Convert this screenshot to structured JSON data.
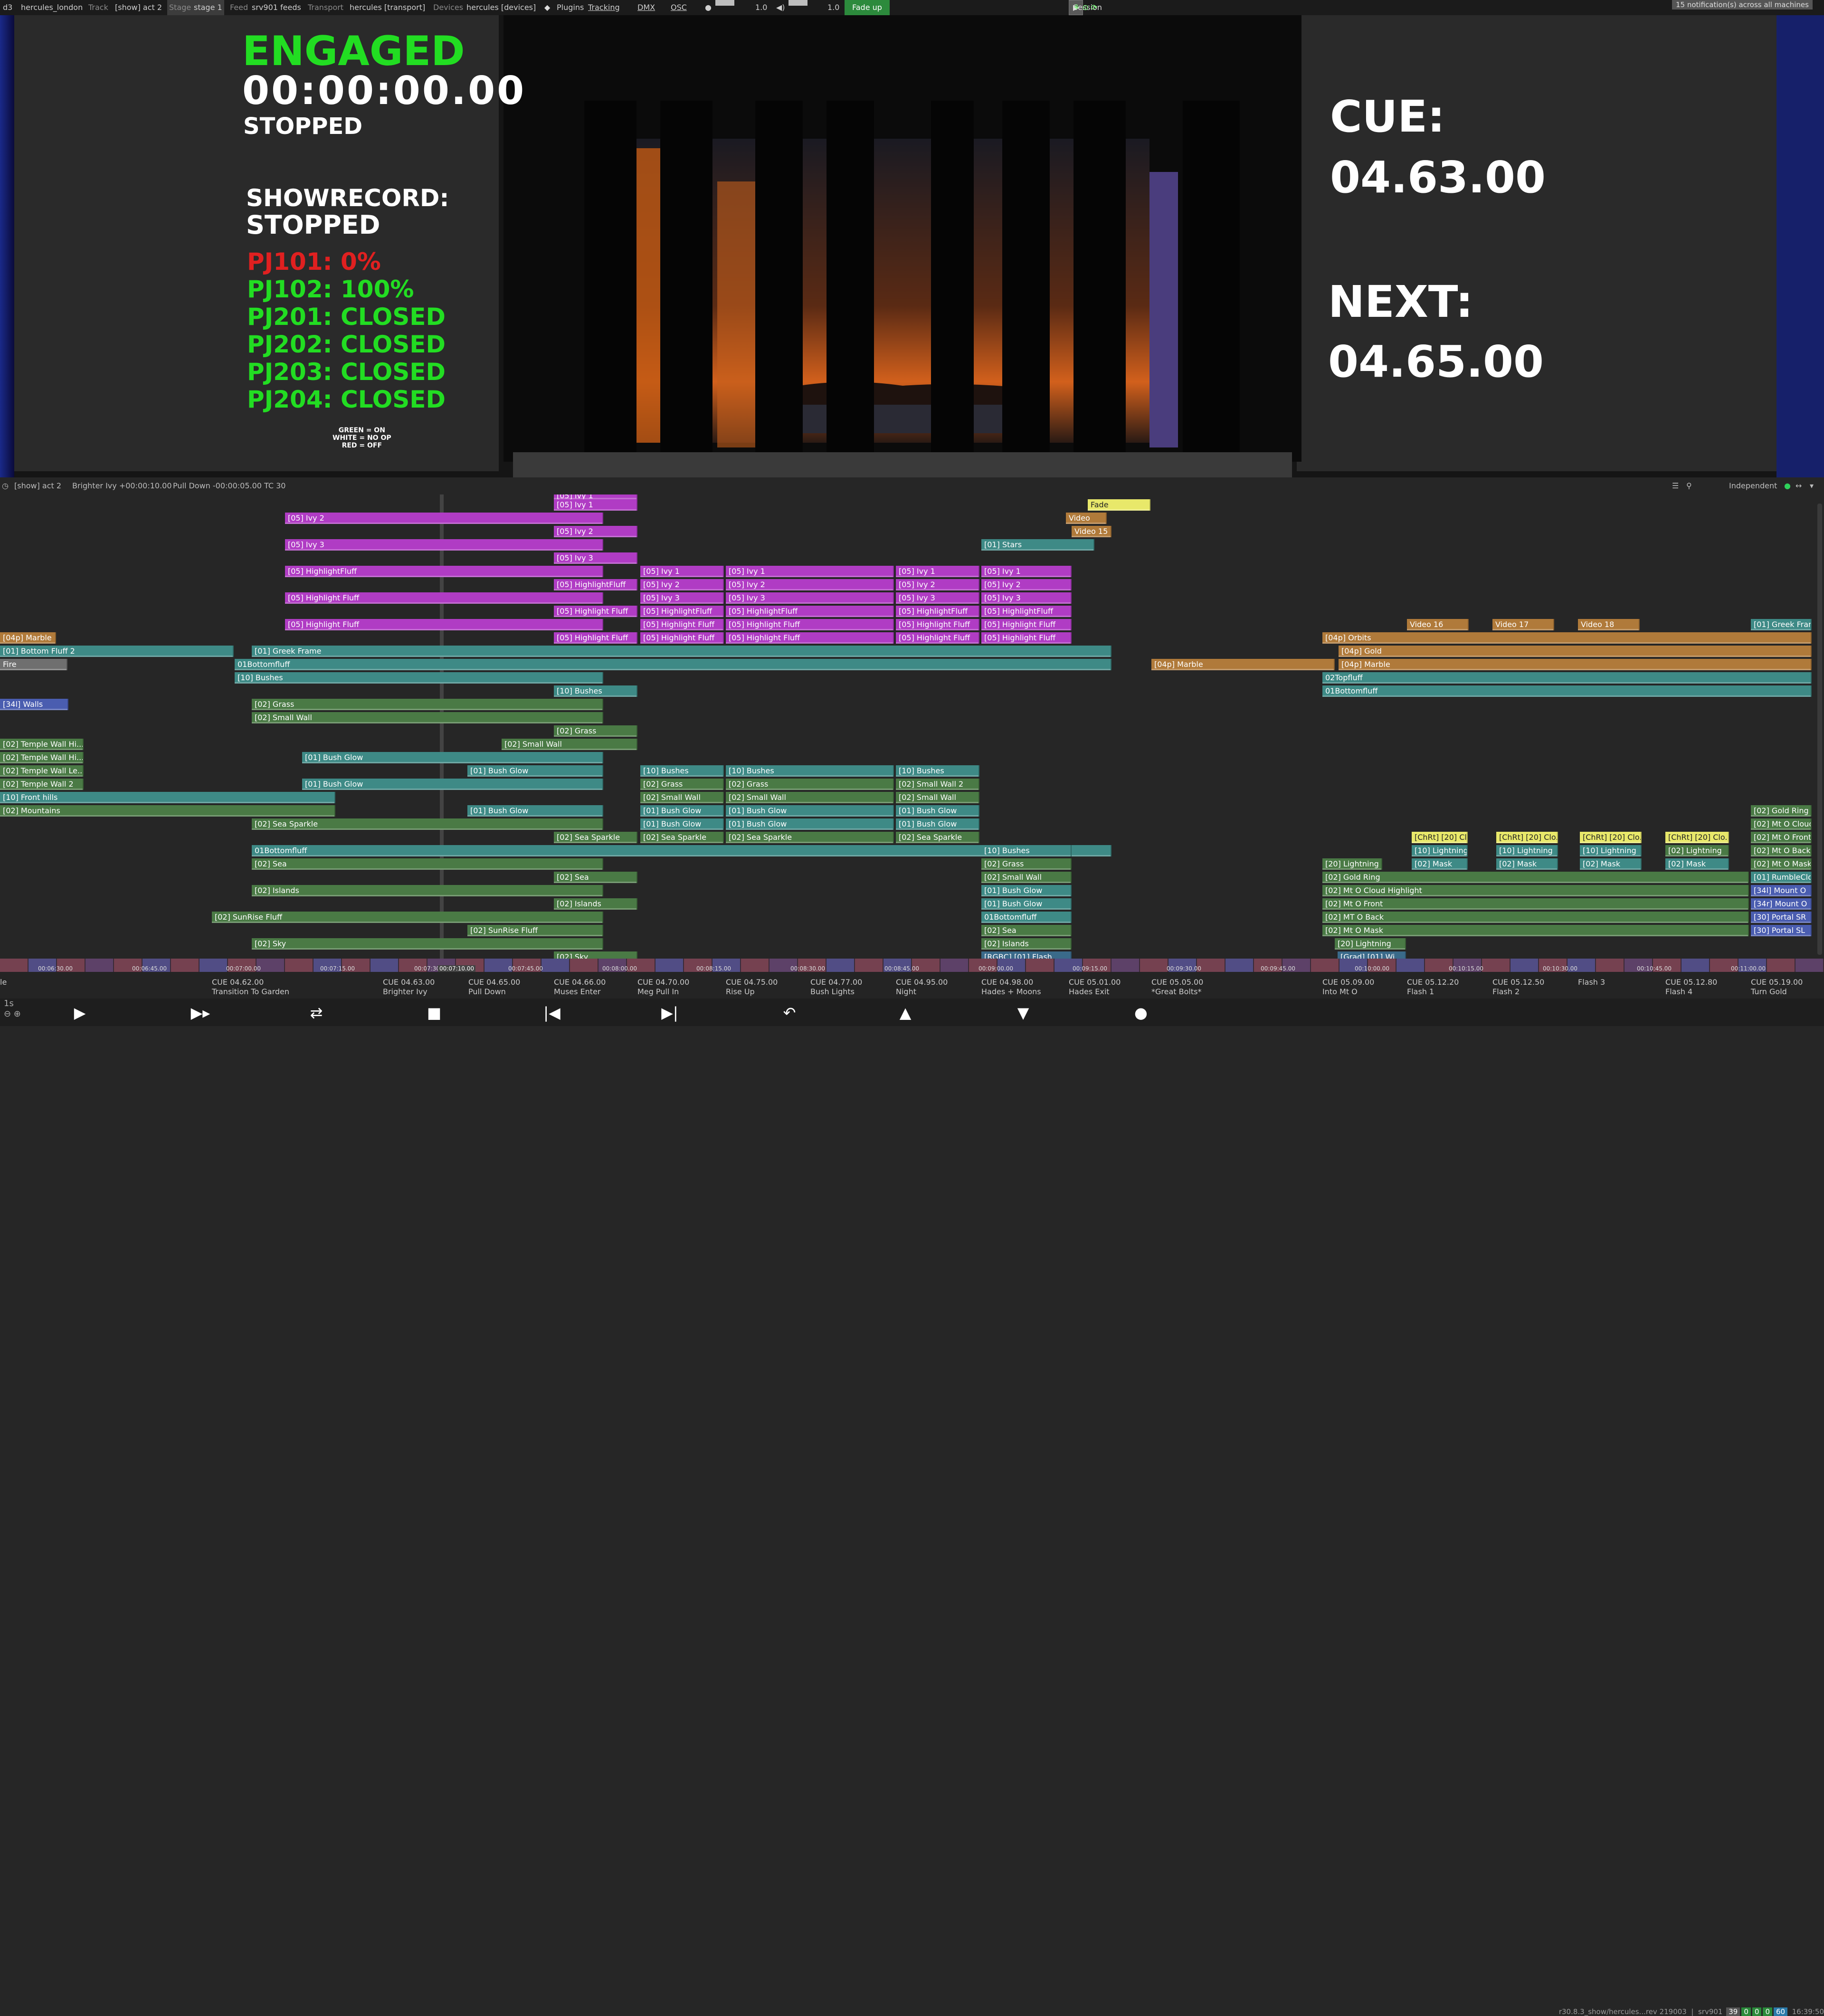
{
  "topbar": {
    "app": "d3",
    "project": "hercules_london",
    "track_label": "Track",
    "track_value": "[show] act 2",
    "stage_label": "Stage",
    "stage_value": "stage 1",
    "feed_label": "Feed",
    "feed_value": "srv901 feeds",
    "transport_label": "Transport",
    "transport_value": "hercules [transport]",
    "devices_label": "Devices",
    "devices_value": "hercules [devices]",
    "plugins": "Plugins",
    "tracking": "Tracking",
    "dmx": "DMX",
    "osc": "OSC",
    "bright_value": "1.0",
    "volume_value": "1.0",
    "fade_button": "Fade up",
    "session_label": "Session",
    "notifications": "15 notification(s) across all machines"
  },
  "hud": {
    "engaged": "ENGAGED",
    "timecode": "00:00:00.00",
    "status": "STOPPED",
    "showrecord_label": "SHOWRECORD:",
    "showrecord_status": "STOPPED",
    "pj_lines": [
      {
        "text": "PJ101: 0%",
        "color": "#e02020"
      },
      {
        "text": "PJ102: 100%",
        "color": "#22dd22"
      },
      {
        "text": "PJ201: CLOSED",
        "color": "#22dd22"
      },
      {
        "text": "PJ202: CLOSED",
        "color": "#22dd22"
      },
      {
        "text": "PJ203: CLOSED",
        "color": "#22dd22"
      },
      {
        "text": "PJ204: CLOSED",
        "color": "#22dd22"
      }
    ],
    "legend": [
      "GREEN = ON",
      "WHITE = NO OP",
      "RED = OFF"
    ],
    "cue_label": "CUE:",
    "cue_value": "04.63.00",
    "next_label": "NEXT:",
    "next_value": "04.65.00"
  },
  "timeline_header": {
    "track": "[show] act 2",
    "current_item": "Brighter Ivy +00:00:10.00",
    "next_item": "Pull Down -00:00:05.00",
    "tc": "TC 30",
    "mode": "Independent"
  },
  "colors": {
    "purple": "#b03cc4",
    "teal": "#3e8a86",
    "green": "#4a7a45",
    "brown": "#b07a3a",
    "gray": "#6f6f6f",
    "blue": "#4a5db0",
    "yellow": "#e8e86a",
    "slate": "#3a6a8a"
  },
  "layers": [
    {
      "t": "[05] Ivy 2",
      "r": 1,
      "c": "purple",
      "s": 0
    },
    {
      "t": "[05] Ivy 3",
      "r": 3,
      "c": "purple",
      "s": 0
    },
    {
      "t": "[05] HighlightFluff",
      "r": 5,
      "c": "purple",
      "s": 0
    },
    {
      "t": "[05] Highlight Fluff",
      "r": 7,
      "c": "purple",
      "s": 0
    },
    {
      "t": "[05] Highlight Fluff",
      "r": 9,
      "c": "purple",
      "s": 0
    },
    {
      "t": "[05] Ivy 1",
      "r": 0,
      "c": "purple",
      "s": 1
    },
    {
      "t": "[05] Ivy 2",
      "r": 2,
      "c": "purple",
      "s": 1
    },
    {
      "t": "[05] Ivy 3",
      "r": 4,
      "c": "purple",
      "s": 1
    },
    {
      "t": "[05] HighlightFluff",
      "r": 6,
      "c": "purple",
      "s": 1
    },
    {
      "t": "[05] Highlight Fluff",
      "r": 8,
      "c": "purple",
      "s": 1
    },
    {
      "t": "[05] Highlight Fluff",
      "r": 10,
      "c": "purple",
      "s": 1
    },
    {
      "t": "[05] Ivy 1",
      "r": 5,
      "c": "purple",
      "s": 2
    },
    {
      "t": "[05] Ivy 2",
      "r": 6,
      "c": "purple",
      "s": 2
    },
    {
      "t": "[05] Ivy 3",
      "r": 7,
      "c": "purple",
      "s": 2
    },
    {
      "t": "[05] HighlightFluff",
      "r": 8,
      "c": "purple",
      "s": 2
    },
    {
      "t": "[05] Highlight Fluff",
      "r": 9,
      "c": "purple",
      "s": 2
    },
    {
      "t": "[05] Highlight Fluff",
      "r": 10,
      "c": "purple",
      "s": 2
    },
    {
      "t": "[05] Ivy 1",
      "r": 5,
      "c": "purple",
      "s": 3
    },
    {
      "t": "[05] Ivy 2",
      "r": 6,
      "c": "purple",
      "s": 3
    },
    {
      "t": "[05] Ivy 3",
      "r": 7,
      "c": "purple",
      "s": 3
    },
    {
      "t": "[05] HighlightFluff",
      "r": 8,
      "c": "purple",
      "s": 3
    },
    {
      "t": "[05] Highlight Fluff",
      "r": 9,
      "c": "purple",
      "s": 3
    },
    {
      "t": "[05] Highlight Fluff",
      "r": 10,
      "c": "purple",
      "s": 3
    },
    {
      "t": "[05] Ivy 1",
      "r": 5,
      "c": "purple",
      "s": 4
    },
    {
      "t": "[05] Ivy 2",
      "r": 6,
      "c": "purple",
      "s": 4
    },
    {
      "t": "[05] Ivy 3",
      "r": 7,
      "c": "purple",
      "s": 4
    },
    {
      "t": "[05] HighlightFluff",
      "r": 8,
      "c": "purple",
      "s": 4
    },
    {
      "t": "[05] Highlight Fluff",
      "r": 9,
      "c": "purple",
      "s": 4
    },
    {
      "t": "[05] Highlight Fluff",
      "r": 10,
      "c": "purple",
      "s": 4
    },
    {
      "t": "[05] Ivy 1",
      "r": 5,
      "c": "purple",
      "s": 5
    },
    {
      "t": "[05] Ivy 2",
      "r": 6,
      "c": "purple",
      "s": 5
    },
    {
      "t": "[05] Ivy 3",
      "r": 7,
      "c": "purple",
      "s": 5
    },
    {
      "t": "[05] HighlightFluff",
      "r": 8,
      "c": "purple",
      "s": 5
    },
    {
      "t": "[05] Highlight Fluff",
      "r": 9,
      "c": "purple",
      "s": 5
    },
    {
      "t": "[05] Highlight Fluff",
      "r": 10,
      "c": "purple",
      "s": 5
    },
    {
      "t": "Fade",
      "r": 0,
      "c": "yellow",
      "s": 6
    },
    {
      "t": "Video",
      "r": 1,
      "c": "brown",
      "s": 7
    },
    {
      "t": "Video 15",
      "r": 2,
      "c": "brown",
      "s": 8
    },
    {
      "t": "[01] Stars",
      "r": 3,
      "c": "teal",
      "s": 9
    },
    {
      "t": "[04p] Marble",
      "r": 10,
      "c": "brown",
      "s": 10
    },
    {
      "t": "[01] Bottom Fluff 2",
      "r": 11,
      "c": "teal",
      "s": 11
    },
    {
      "t": "[01] Greek Frame",
      "r": 11,
      "c": "teal",
      "s": 12
    },
    {
      "t": "Fire",
      "r": 12,
      "c": "gray",
      "s": 13
    },
    {
      "t": "01Bottomfluff",
      "r": 12,
      "c": "teal",
      "s": 14
    },
    {
      "t": "[10] Bushes",
      "r": 13,
      "c": "teal",
      "s": 15
    },
    {
      "t": "[10] Bushes",
      "r": 14,
      "c": "teal",
      "s": 16
    },
    {
      "t": "[34l] Walls",
      "r": 15,
      "c": "blue",
      "s": 17
    },
    {
      "t": "[02] Grass",
      "r": 15,
      "c": "green",
      "s": 18
    },
    {
      "t": "[02] Small Wall",
      "r": 16,
      "c": "green",
      "s": 18
    },
    {
      "t": "[02] Grass",
      "r": 17,
      "c": "green",
      "s": 19
    },
    {
      "t": "[02] Small Wall",
      "r": 18,
      "c": "green",
      "s": 20
    },
    {
      "t": "[02] Temple Wall Hi...",
      "r": 18,
      "c": "green",
      "s": 21
    },
    {
      "t": "[02] Temple Wall Hi...",
      "r": 19,
      "c": "green",
      "s": 21
    },
    {
      "t": "[02] Temple Wall Le...",
      "r": 20,
      "c": "green",
      "s": 21
    },
    {
      "t": "[02] Temple Wall 2",
      "r": 21,
      "c": "green",
      "s": 21
    },
    {
      "t": "[01] Bush Glow",
      "r": 19,
      "c": "teal",
      "s": 22
    },
    {
      "t": "[01] Bush Glow",
      "r": 21,
      "c": "teal",
      "s": 22
    },
    {
      "t": "[01] Bush Glow",
      "r": 20,
      "c": "teal",
      "s": 23
    },
    {
      "t": "[10] Front hills",
      "r": 22,
      "c": "teal",
      "s": 24
    },
    {
      "t": "[02] Mountains",
      "r": 23,
      "c": "green",
      "s": 24
    },
    {
      "t": "[01] Bush Glow",
      "r": 23,
      "c": "teal",
      "s": 23
    },
    {
      "t": "[02] Sea Sparkle",
      "r": 24,
      "c": "green",
      "s": 25
    },
    {
      "t": "[02] Sea Sparkle",
      "r": 25,
      "c": "green",
      "s": 26
    },
    {
      "t": "[10] Bushes",
      "r": 20,
      "c": "teal",
      "s": 2
    },
    {
      "t": "[02] Grass",
      "r": 21,
      "c": "green",
      "s": 2
    },
    {
      "t": "[02] Small Wall",
      "r": 22,
      "c": "green",
      "s": 2
    },
    {
      "t": "[01] Bush Glow",
      "r": 23,
      "c": "teal",
      "s": 2
    },
    {
      "t": "[01] Bush Glow",
      "r": 24,
      "c": "teal",
      "s": 2
    },
    {
      "t": "[02] Sea Sparkle",
      "r": 25,
      "c": "green",
      "s": 2
    },
    {
      "t": "[10] Bushes",
      "r": 20,
      "c": "teal",
      "s": 3
    },
    {
      "t": "[02] Grass",
      "r": 21,
      "c": "green",
      "s": 3
    },
    {
      "t": "[02] Small Wall",
      "r": 22,
      "c": "green",
      "s": 3
    },
    {
      "t": "[01] Bush Glow",
      "r": 23,
      "c": "teal",
      "s": 3
    },
    {
      "t": "[01] Bush Glow",
      "r": 24,
      "c": "teal",
      "s": 3
    },
    {
      "t": "[02] Sea Sparkle",
      "r": 25,
      "c": "green",
      "s": 3
    },
    {
      "t": "[10] Bushes",
      "r": 20,
      "c": "teal",
      "s": 4
    },
    {
      "t": "[02] Small Wall 2",
      "r": 21,
      "c": "green",
      "s": 4
    },
    {
      "t": "[02] Small Wall",
      "r": 22,
      "c": "green",
      "s": 4
    },
    {
      "t": "[01] Bush Glow",
      "r": 23,
      "c": "teal",
      "s": 4
    },
    {
      "t": "[01] Bush Glow",
      "r": 24,
      "c": "teal",
      "s": 4
    },
    {
      "t": "[02] Sea Sparkle",
      "r": 25,
      "c": "green",
      "s": 4
    },
    {
      "t": "01Bottomfluff",
      "r": 26,
      "c": "teal",
      "s": 27
    },
    {
      "t": "[02] Sea",
      "r": 27,
      "c": "green",
      "s": 18
    },
    {
      "t": "[02] Sea",
      "r": 28,
      "c": "green",
      "s": 1
    },
    {
      "t": "[02] Islands",
      "r": 29,
      "c": "green",
      "s": 18
    },
    {
      "t": "[02] Islands",
      "r": 30,
      "c": "green",
      "s": 1
    },
    {
      "t": "[02] SunRise Fluff",
      "r": 31,
      "c": "green",
      "s": 28
    },
    {
      "t": "[02] SunRise Fluff",
      "r": 32,
      "c": "green",
      "s": 23
    },
    {
      "t": "[02] Sky",
      "r": 33,
      "c": "green",
      "s": 18
    },
    {
      "t": "[02] Sky",
      "r": 34,
      "c": "green",
      "s": 1
    },
    {
      "t": "[10] Bushes",
      "r": 26,
      "c": "teal",
      "s": 29
    },
    {
      "t": "[02] Grass",
      "r": 27,
      "c": "green",
      "s": 29
    },
    {
      "t": "[02] Small Wall",
      "r": 28,
      "c": "green",
      "s": 29
    },
    {
      "t": "[01] Bush Glow",
      "r": 29,
      "c": "teal",
      "s": 30
    },
    {
      "t": "[01] Bush Glow",
      "r": 30,
      "c": "teal",
      "s": 30
    },
    {
      "t": "01Bottomfluff",
      "r": 31,
      "c": "teal",
      "s": 30
    },
    {
      "t": "[02] Sea",
      "r": 32,
      "c": "green",
      "s": 29
    },
    {
      "t": "[02] Islands",
      "r": 33,
      "c": "green",
      "s": 29
    },
    {
      "t": "[RGBC] [01] Flash",
      "r": 34,
      "c": "slate",
      "s": 30
    },
    {
      "t": "[04p] Marble",
      "r": 12,
      "c": "brown",
      "s": 31
    },
    {
      "t": "Video 16",
      "r": 9,
      "c": "brown",
      "s": 32
    },
    {
      "t": "Video 17",
      "r": 9,
      "c": "brown",
      "s": 33
    },
    {
      "t": "Video 18",
      "r": 9,
      "c": "brown",
      "s": 34
    },
    {
      "t": "[01] Greek Fram",
      "r": 9,
      "c": "teal",
      "s": 35
    },
    {
      "t": "[04p] Orbits",
      "r": 10,
      "c": "brown",
      "s": 36
    },
    {
      "t": "[04p] Gold",
      "r": 11,
      "c": "brown",
      "s": 37
    },
    {
      "t": "[04p] Marble",
      "r": 12,
      "c": "brown",
      "s": 37
    },
    {
      "t": "02Topfluff",
      "r": 13,
      "c": "teal",
      "s": 36
    },
    {
      "t": "01Bottomfluff",
      "r": 14,
      "c": "teal",
      "s": 36
    },
    {
      "t": "[02] Gold Ring",
      "r": 23,
      "c": "green",
      "s": 35
    },
    {
      "t": "[02] Mt O Cloud",
      "r": 24,
      "c": "green",
      "s": 35
    },
    {
      "t": "[02] Mt O Front",
      "r": 25,
      "c": "green",
      "s": 35
    },
    {
      "t": "[02] Mt O Back",
      "r": 26,
      "c": "green",
      "s": 35
    },
    {
      "t": "[02] Mt O Mask",
      "r": 27,
      "c": "green",
      "s": 35
    },
    {
      "t": "[01] RumbleClo",
      "r": 28,
      "c": "teal",
      "s": 35
    },
    {
      "t": "[34l] Mount O",
      "r": 29,
      "c": "blue",
      "s": 35
    },
    {
      "t": "[34r] Mount O",
      "r": 30,
      "c": "blue",
      "s": 35
    },
    {
      "t": "[30] Portal SR",
      "r": 31,
      "c": "blue",
      "s": 35
    },
    {
      "t": "[30] Portal SL",
      "r": 32,
      "c": "blue",
      "s": 35
    },
    {
      "t": "[ChRt] [20] Clo...",
      "r": 25,
      "c": "yellow",
      "s": 38
    },
    {
      "t": "[ChRt] [20] Clo...",
      "r": 25,
      "c": "yellow",
      "s": 39
    },
    {
      "t": "[ChRt] [20] Clo...",
      "r": 25,
      "c": "yellow",
      "s": 40
    },
    {
      "t": "[ChRt] [20] Clo...",
      "r": 25,
      "c": "yellow",
      "s": 41
    },
    {
      "t": "[10] Lightning",
      "r": 26,
      "c": "teal",
      "s": 38
    },
    {
      "t": "[10] Lightning",
      "r": 26,
      "c": "teal",
      "s": 39
    },
    {
      "t": "[10] Lightning",
      "r": 26,
      "c": "teal",
      "s": 40
    },
    {
      "t": "[02] Lightning",
      "r": 26,
      "c": "green",
      "s": 41
    },
    {
      "t": "[02] Mask",
      "r": 27,
      "c": "teal",
      "s": 38
    },
    {
      "t": "[02] Mask",
      "r": 27,
      "c": "teal",
      "s": 39
    },
    {
      "t": "[02] Mask",
      "r": 27,
      "c": "teal",
      "s": 40
    },
    {
      "t": "[02] Mask",
      "r": 27,
      "c": "teal",
      "s": 41
    },
    {
      "t": "[20] Lightning",
      "r": 27,
      "c": "green",
      "s": 42
    },
    {
      "t": "[02] Gold Ring",
      "r": 28,
      "c": "green",
      "s": 43
    },
    {
      "t": "[02] Mt O Cloud Highlight",
      "r": 29,
      "c": "green",
      "s": 43
    },
    {
      "t": "[02] Mt O Front",
      "r": 30,
      "c": "green",
      "s": 43
    },
    {
      "t": "[02] MT O Back",
      "r": 31,
      "c": "green",
      "s": 43
    },
    {
      "t": "[02] Mt O Mask",
      "r": 32,
      "c": "green",
      "s": 43
    },
    {
      "t": "[20] Lightning",
      "r": 33,
      "c": "green",
      "s": 44
    },
    {
      "t": "[Grad] [01] Wi...",
      "r": 34,
      "c": "slate",
      "s": 45
    }
  ],
  "partial_top": [
    {
      "t": "[05] Ivy 1",
      "s": 1
    }
  ],
  "cues": [
    {
      "id": "",
      "name": "le"
    },
    {
      "id": "CUE 04.62.00",
      "name": "Transition To Garden"
    },
    {
      "id": "CUE 04.63.00",
      "name": "Brighter Ivy"
    },
    {
      "id": "CUE 04.65.00",
      "name": "Pull Down"
    },
    {
      "id": "CUE 04.66.00",
      "name": "Muses Enter"
    },
    {
      "id": "CUE 04.70.00",
      "name": "Meg Pull In"
    },
    {
      "id": "CUE 04.75.00",
      "name": "Rise Up"
    },
    {
      "id": "CUE 04.77.00",
      "name": "Bush Lights"
    },
    {
      "id": "CUE 04.95.00",
      "name": "Night"
    },
    {
      "id": "CUE 04.98.00",
      "name": "Hades + Moons"
    },
    {
      "id": "CUE 05.01.00",
      "name": "Hades Exit"
    },
    {
      "id": "CUE 05.05.00",
      "name": "*Great Bolts*"
    },
    {
      "id": "CUE 05.09.00",
      "name": "Into Mt O"
    },
    {
      "id": "CUE 05.12.20",
      "name": "Flash 1"
    },
    {
      "id": "CUE 05.12.50",
      "name": "Flash 2"
    },
    {
      "id": "",
      "name": "Flash 3"
    },
    {
      "id": "CUE 05.12.80",
      "name": "Flash 4"
    },
    {
      "id": "CUE 05.19.00",
      "name": "Turn Gold"
    }
  ],
  "ruler_ticks": [
    "00:06:30.00",
    "00:06:45.00",
    "00:07:00.00",
    "00:07:15.00",
    "00:07:30.00",
    "00:07:45.00",
    "00:08:00.00",
    "00:08:15.00",
    "00:08:30.00",
    "00:08:45.00",
    "00:09:00.00",
    "00:09:15.00",
    "00:09:30.00",
    "00:09:45.00",
    "00:10:00.00",
    "00:10:15.00",
    "00:10:30.00",
    "00:10:45.00",
    "00:11:00.00"
  ],
  "playhead_time": "00:07:10.00",
  "footer": {
    "version": "r30.8.3_show/hercules...rev 219003",
    "machine": "srv901",
    "stats": [
      "39",
      "0",
      "0",
      "0",
      "60"
    ],
    "clock": "16:39:50"
  }
}
